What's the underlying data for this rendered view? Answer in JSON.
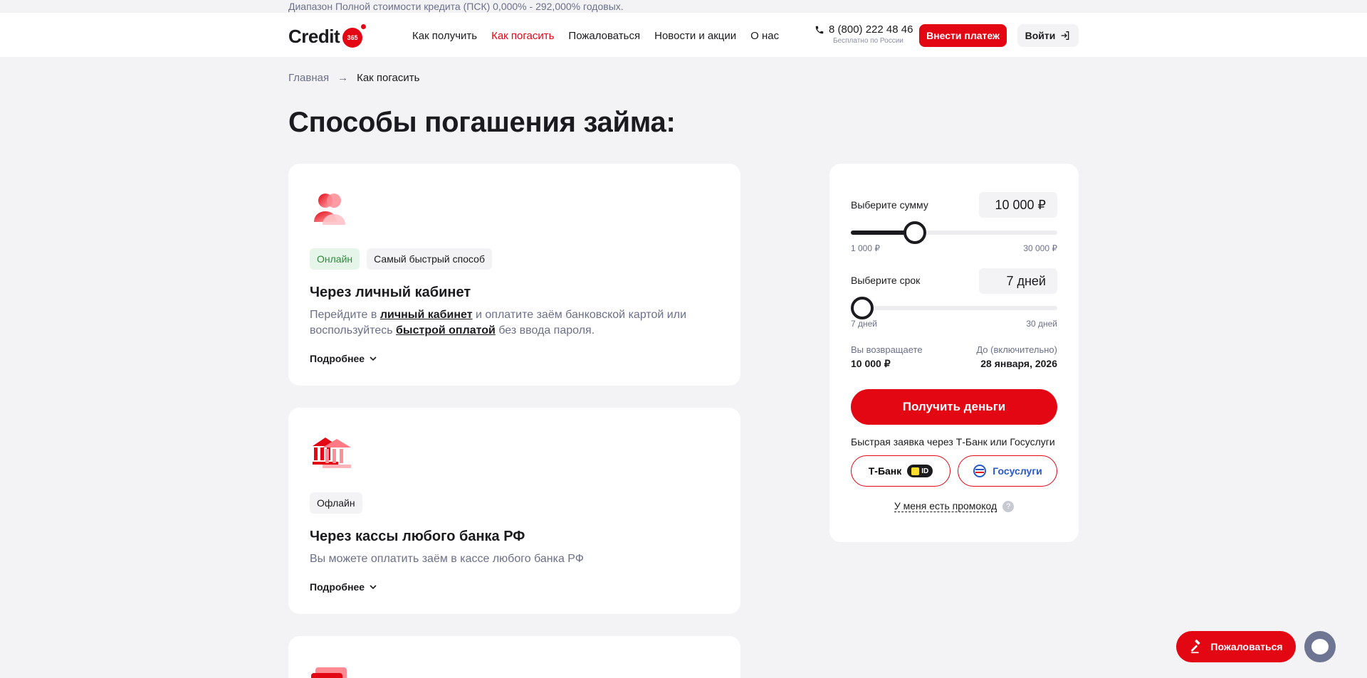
{
  "topline": "Диапазон Полной стоимости кредита (ПСК) 0,000% - 292,000% годовых.",
  "header": {
    "logo_text": "Credit",
    "logo_badge": "365",
    "nav": [
      {
        "label": "Как получить"
      },
      {
        "label": "Как погасить"
      },
      {
        "label": "Пожаловаться"
      },
      {
        "label": "Новости и акции"
      },
      {
        "label": "О нас"
      }
    ],
    "phone": "8 (800) 222 48 46",
    "phone_note": "Бесплатно по России",
    "pay_button": "Внести платеж",
    "login_button": "Войти"
  },
  "breadcrumb": {
    "home": "Главная",
    "arrow": "→",
    "current": "Как погасить"
  },
  "page_title": "Способы погашения займа:",
  "cards": [
    {
      "tags": [
        "Онлайн",
        "Самый быстрый способ"
      ],
      "title": "Через личный кабинет",
      "text_1": "Перейдите в ",
      "link_1": "личный кабинет",
      "text_2": " и оплатите заём банковской картой или воспользуйтесь ",
      "link_2": "быстрой оплатой",
      "text_3": " без ввода пароля.",
      "more": "Подробнее"
    },
    {
      "tags": [
        "Офлайн"
      ],
      "title": "Через кассы любого банка РФ",
      "text": "Вы можете оплатить заём в кассе любого банка РФ",
      "more": "Подробнее"
    }
  ],
  "calc": {
    "sum_label": "Выберите сумму",
    "sum_value": "10 000 ₽",
    "sum_min": "1 000 ₽",
    "sum_max": "30 000 ₽",
    "sum_fraction": 0.31,
    "term_label": "Выберите срок",
    "term_value": "7 дней",
    "term_min": "7 дней",
    "term_max": "30 дней",
    "term_fraction": 0,
    "return_label": "Вы возвращаете",
    "return_value": "10 000 ₽",
    "until_label": "До (включительно)",
    "until_value": "28 января, 2026",
    "get_button": "Получить деньги",
    "quick_text": "Быстрая заявка через Т-Банк или Госуслуги",
    "tbank_button": "Т-Банк",
    "tbank_id": "ID",
    "gosuslugi_button": "Госуслуги",
    "promo": "У меня есть промокод",
    "promo_help": "?"
  },
  "float": {
    "complain_button": "Пожаловаться"
  },
  "colors": {
    "accent": "#e30613",
    "background": "#f3f3f5",
    "muted": "#6b7088",
    "success": "#2c8a3c"
  }
}
